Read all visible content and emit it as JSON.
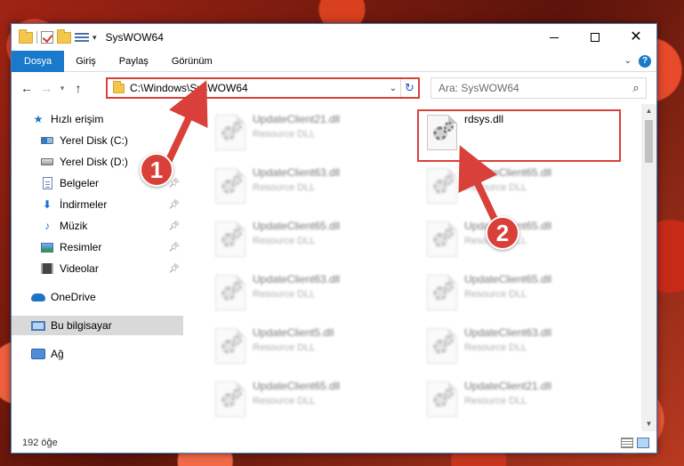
{
  "window": {
    "title": "SysWOW64"
  },
  "ribbon": {
    "tabs": [
      "Dosya",
      "Giriş",
      "Paylaş",
      "Görünüm"
    ]
  },
  "address": {
    "path": "C:\\Windows\\SysWOW64"
  },
  "search": {
    "placeholder": "Ara: SysWOW64"
  },
  "sidebar": {
    "items": [
      {
        "label": "Hızlı erişim",
        "icon": "star-icon"
      },
      {
        "label": "Yerel Disk (C:)",
        "icon": "drive-icon"
      },
      {
        "label": "Yerel Disk (D:)",
        "icon": "drive-icon"
      },
      {
        "label": "Belgeler",
        "icon": "documents-icon"
      },
      {
        "label": "İndirmeler",
        "icon": "downloads-icon"
      },
      {
        "label": "Müzik",
        "icon": "music-icon"
      },
      {
        "label": "Resimler",
        "icon": "pictures-icon"
      },
      {
        "label": "Videolar",
        "icon": "videos-icon"
      },
      {
        "label": "OneDrive",
        "icon": "onedrive-icon"
      },
      {
        "label": "Bu bilgisayar",
        "icon": "computer-icon"
      },
      {
        "label": "Ağ",
        "icon": "network-icon"
      }
    ]
  },
  "files": {
    "left": [
      {
        "name": "UpdateClient21.dll",
        "type": "Resource DLL"
      },
      {
        "name": "UpdateClient63.dll",
        "type": "Resource DLL"
      },
      {
        "name": "UpdateClient65.dll",
        "type": "Resource DLL"
      },
      {
        "name": "UpdateClient63.dll",
        "type": "Resource DLL"
      },
      {
        "name": "UpdateClient5.dll",
        "type": "Resource DLL"
      },
      {
        "name": "UpdateClient65.dll",
        "type": "Resource DLL"
      }
    ],
    "right": [
      {
        "name": "rdsys.dll",
        "type": ""
      },
      {
        "name": "UpdateClient65.dll",
        "type": "Resource DLL"
      },
      {
        "name": "UpdateClient65.dll",
        "type": "Resource DLL"
      },
      {
        "name": "UpdateClient65.dll",
        "type": "Resource DLL"
      },
      {
        "name": "UpdateClient63.dll",
        "type": "Resource DLL"
      },
      {
        "name": "UpdateClient21.dll",
        "type": "Resource DLL"
      }
    ]
  },
  "status": {
    "count": "192 öğe"
  },
  "callouts": {
    "one": "1",
    "two": "2"
  },
  "colors": {
    "accent": "#1979ca",
    "annotation": "#d9403a"
  }
}
